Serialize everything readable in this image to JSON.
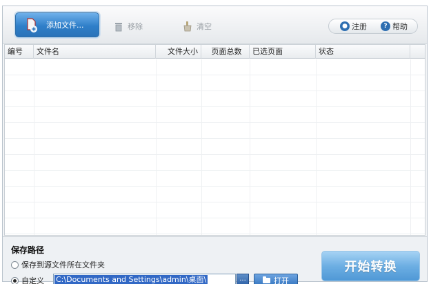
{
  "toolbar": {
    "add_label": "添加文件...",
    "remove_label": "移除",
    "clear_label": "清空",
    "register_label": "注册",
    "help_label": "帮助"
  },
  "table": {
    "columns": [
      "编号",
      "文件名",
      "文件大小",
      "页面总数",
      "已选页面",
      "状态"
    ],
    "rows": []
  },
  "save": {
    "title": "保存路径",
    "option_source": "保存到源文件所在文件夹",
    "option_custom": "自定义",
    "path_value": "C:\\Documents and Settings\\admin\\桌面\\",
    "browse_label": "...",
    "open_label": "打开",
    "start_label": "开始转换"
  },
  "colors": {
    "accent": "#2f7fc9",
    "start_button": "#5fa8e2",
    "selection": "#3168c5"
  }
}
